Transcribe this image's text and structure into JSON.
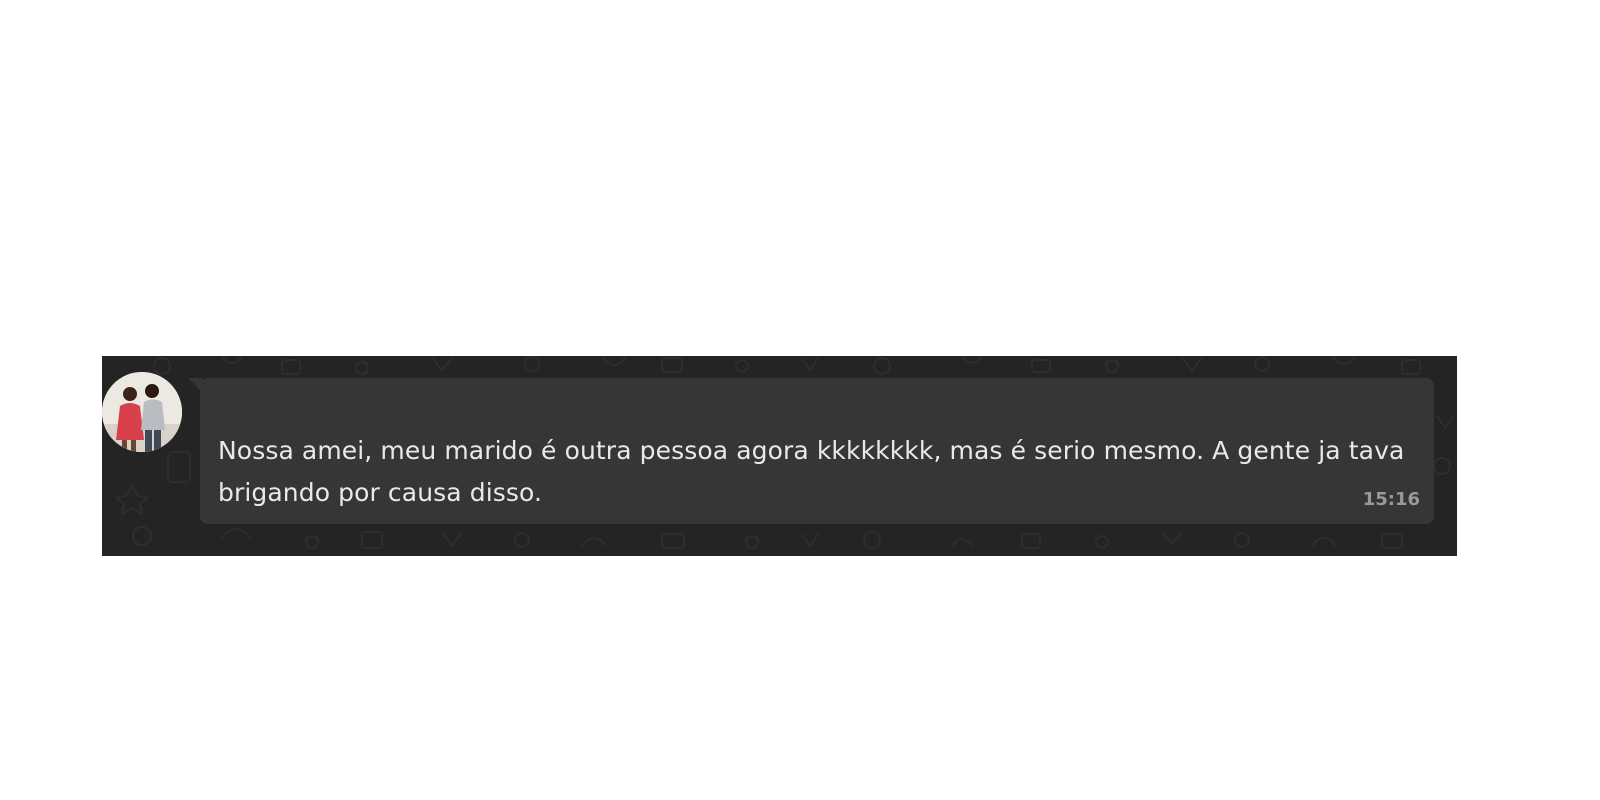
{
  "chat": {
    "avatar_icon": "contact-photo-couple",
    "background_color": "#242424",
    "bubble_color": "#363636",
    "message": {
      "text": "Nossa amei, meu marido é outra pessoa agora kkkkkkkk, mas é serio mesmo. A gente ja tava brigando por causa disso.",
      "time": "15:16"
    }
  }
}
